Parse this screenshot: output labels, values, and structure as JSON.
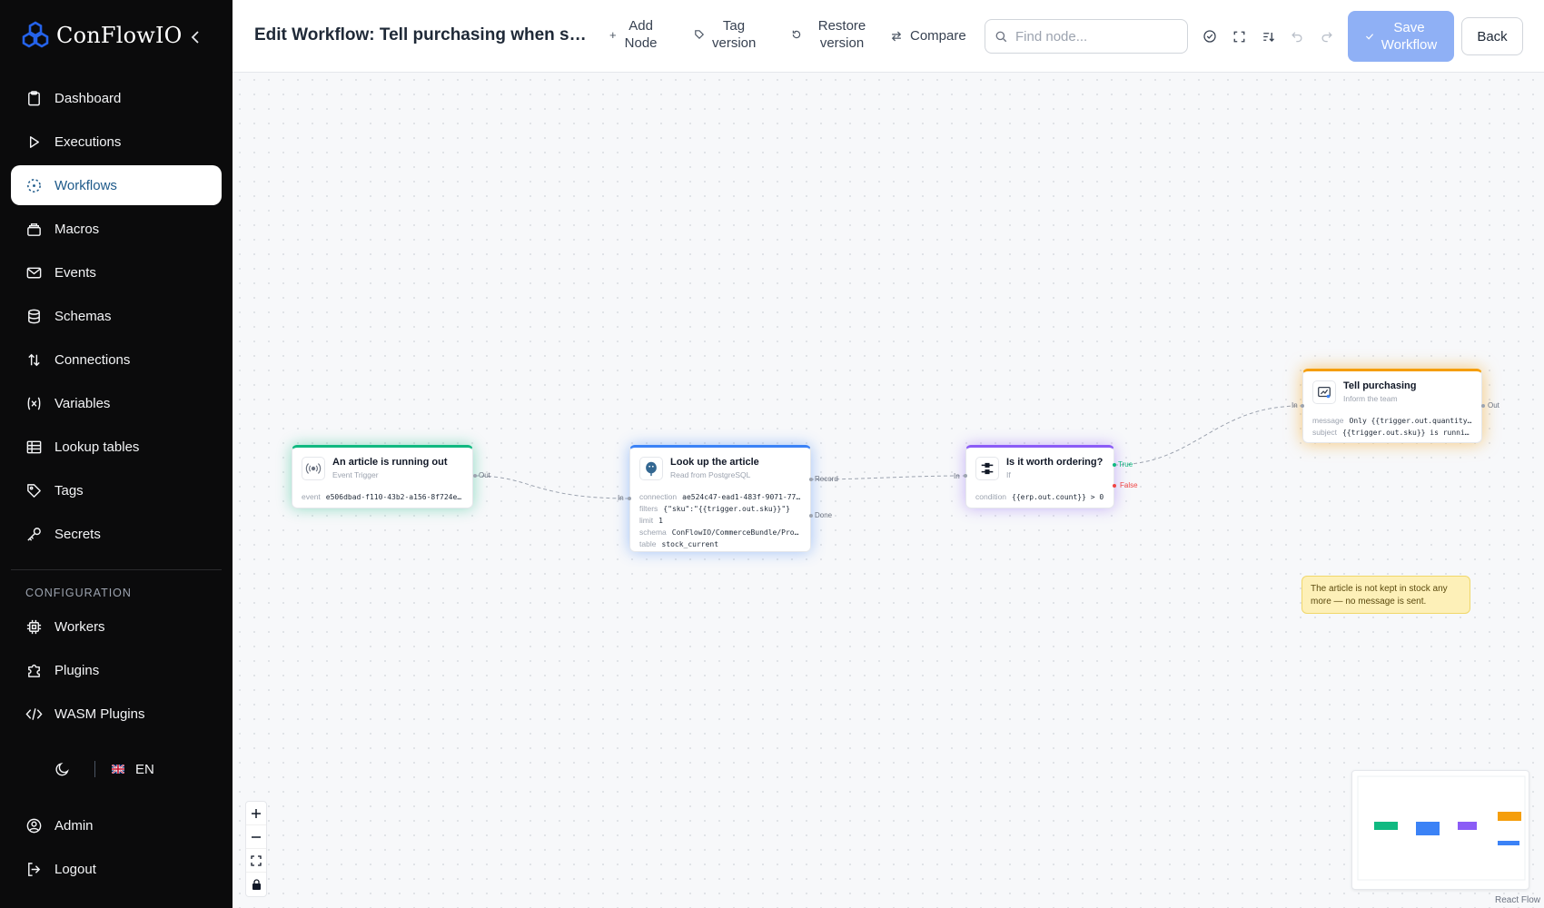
{
  "app": {
    "brand": "ConFlowIO"
  },
  "sidebar": {
    "items": [
      {
        "label": "Dashboard",
        "icon": "clipboard-icon"
      },
      {
        "label": "Executions",
        "icon": "play-icon"
      },
      {
        "label": "Workflows",
        "icon": "workflow-icon",
        "active": true
      },
      {
        "label": "Macros",
        "icon": "layers-icon"
      },
      {
        "label": "Events",
        "icon": "mail-icon"
      },
      {
        "label": "Schemas",
        "icon": "database-icon"
      },
      {
        "label": "Connections",
        "icon": "arrows-updown-icon"
      },
      {
        "label": "Variables",
        "icon": "variable-icon"
      },
      {
        "label": "Lookup tables",
        "icon": "table-icon"
      },
      {
        "label": "Tags",
        "icon": "tag-icon"
      },
      {
        "label": "Secrets",
        "icon": "key-icon"
      }
    ],
    "section_label": "CONFIGURATION",
    "config_items": [
      {
        "label": "Workers",
        "icon": "cpu-icon"
      },
      {
        "label": "Plugins",
        "icon": "puzzle-icon"
      },
      {
        "label": "WASM Plugins",
        "icon": "code-icon"
      }
    ],
    "language": "EN",
    "bottom_items": [
      {
        "label": "Admin",
        "icon": "user-circle-icon"
      },
      {
        "label": "Logout",
        "icon": "logout-icon"
      }
    ]
  },
  "topbar": {
    "title": "Edit Workflow: Tell purchasing when stock is running low",
    "add_node_label": "Add Node",
    "tag_version_label": "Tag version",
    "restore_version_label": "Restore version",
    "compare_label": "Compare",
    "search_placeholder": "Find node...",
    "save_label": "Save Workflow",
    "back_label": "Back"
  },
  "nodes": {
    "trigger": {
      "title": "An article is running out",
      "subtitle": "Event Trigger",
      "props": [
        {
          "k": "event",
          "v": "e506dbad-f110-43b2-a156-8f724e..."
        }
      ],
      "out_port": "Out",
      "color": "#10b981"
    },
    "lookup": {
      "title": "Look up the article",
      "subtitle": "Read from PostgreSQL",
      "props": [
        {
          "k": "connection",
          "v": "ae524c47-ead1-483f-9071-77..."
        },
        {
          "k": "filters",
          "v": "{\"sku\":\"{{trigger.out.sku}}\"}"
        },
        {
          "k": "limit",
          "v": "1"
        },
        {
          "k": "schema",
          "v": "ConFlowIO/CommerceBundle/Pro..."
        },
        {
          "k": "table",
          "v": "stock_current"
        }
      ],
      "in_port": "In",
      "record_port": "Record",
      "done_port": "Done",
      "color": "#3b82f6"
    },
    "decision": {
      "title": "Is it worth ordering?",
      "subtitle": "If",
      "props": [
        {
          "k": "condition",
          "v": "{{erp.out.count}} > 0"
        }
      ],
      "in_port": "In",
      "true_port": "True",
      "false_port": "False",
      "color": "#8b5cf6"
    },
    "notify": {
      "title": "Tell purchasing",
      "subtitle": "Inform the team",
      "props": [
        {
          "k": "message",
          "v": "Only {{trigger.out.quantity}}..."
        },
        {
          "k": "subject",
          "v": "{{trigger.out.sku}} is runnin..."
        }
      ],
      "in_port": "In",
      "out_port": "Out",
      "color": "#f59e0b"
    }
  },
  "note": {
    "text": "The article is not kept in stock any more — no message is sent."
  },
  "canvas": {
    "attribution": "React Flow"
  }
}
